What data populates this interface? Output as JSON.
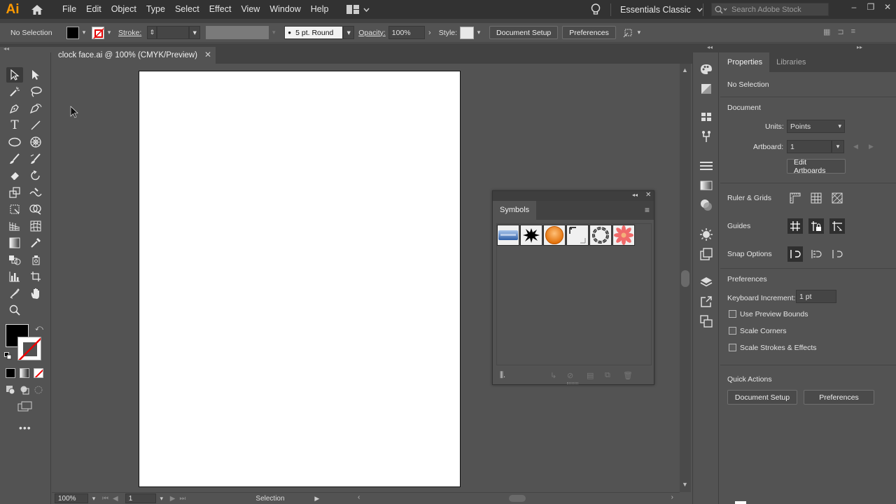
{
  "app": {
    "logo": "Ai",
    "workspace": "Essentials Classic",
    "search_placeholder": "Search Adobe Stock"
  },
  "menu": [
    "File",
    "Edit",
    "Object",
    "Type",
    "Select",
    "Effect",
    "View",
    "Window",
    "Help"
  ],
  "control": {
    "selection": "No Selection",
    "stroke_label": "Stroke:",
    "brush": "5 pt. Round",
    "opacity_label": "Opacity:",
    "opacity": "100%",
    "style_label": "Style:",
    "doc_setup": "Document Setup",
    "preferences": "Preferences"
  },
  "document": {
    "tab_title": "clock face.ai @ 100% (CMYK/Preview)"
  },
  "status": {
    "zoom": "100%",
    "artboard": "1",
    "tool": "Selection"
  },
  "properties": {
    "tabs": [
      "Properties",
      "Libraries"
    ],
    "selection": "No Selection",
    "document": "Document",
    "units_label": "Units:",
    "units": "Points",
    "artboard_label": "Artboard:",
    "artboard": "1",
    "edit_artboards": "Edit Artboards",
    "ruler_grids": "Ruler & Grids",
    "guides": "Guides",
    "snap_options": "Snap Options",
    "preferences": "Preferences",
    "kb_label": "Keyboard Increment:",
    "kb_value": "1 pt",
    "use_preview": "Use Preview Bounds",
    "scale_corners": "Scale Corners",
    "scale_strokes": "Scale Strokes & Effects",
    "quick_actions": "Quick Actions",
    "qa_doc_setup": "Document Setup",
    "qa_preferences": "Preferences"
  },
  "symbols": {
    "title": "Symbols"
  },
  "colors": {
    "accent": "#ff9a00",
    "fill": "#000000",
    "panel": "#535353"
  }
}
